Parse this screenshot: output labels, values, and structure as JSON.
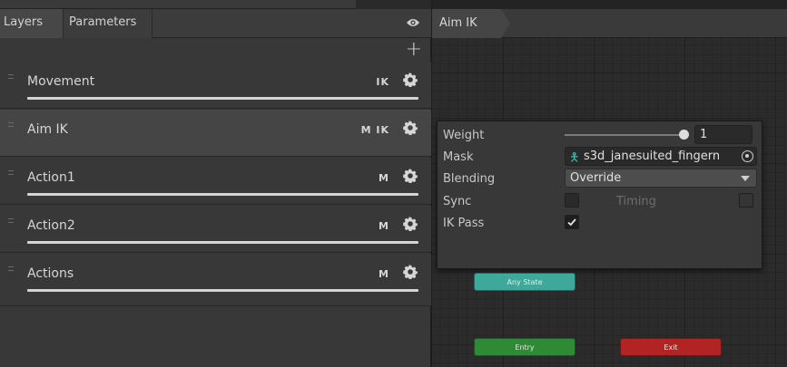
{
  "left_panel": {
    "tabs": [
      {
        "label": "Layers",
        "active": true
      },
      {
        "label": "Parameters",
        "active": false
      }
    ],
    "layers": [
      {
        "name": "Movement",
        "flags": "IK",
        "selected": false
      },
      {
        "name": "Aim IK",
        "flags": "M IK",
        "selected": true
      },
      {
        "name": "Action1",
        "flags": "M",
        "selected": false
      },
      {
        "name": "Action2",
        "flags": "M",
        "selected": false
      },
      {
        "name": "Actions",
        "flags": "M",
        "selected": false
      }
    ],
    "add_symbol": "+"
  },
  "right_panel": {
    "breadcrumb": "Aim IK",
    "settings": {
      "weight_label": "Weight",
      "weight_value": "1",
      "weight_fraction": 1,
      "mask_label": "Mask",
      "mask_value": "s3d_janesuited_fingern",
      "blending_label": "Blending",
      "blending_value": "Override",
      "sync_label": "Sync",
      "sync_checked": false,
      "timing_label": "Timing",
      "timing_checked": false,
      "ikpass_label": "IK Pass",
      "ikpass_checked": true
    },
    "nodes": {
      "any_state": "Any State",
      "entry": "Entry",
      "exit": "Exit"
    }
  },
  "colors": {
    "any_state": "#3ea89a",
    "entry": "#2f8a35",
    "exit": "#b22424"
  }
}
